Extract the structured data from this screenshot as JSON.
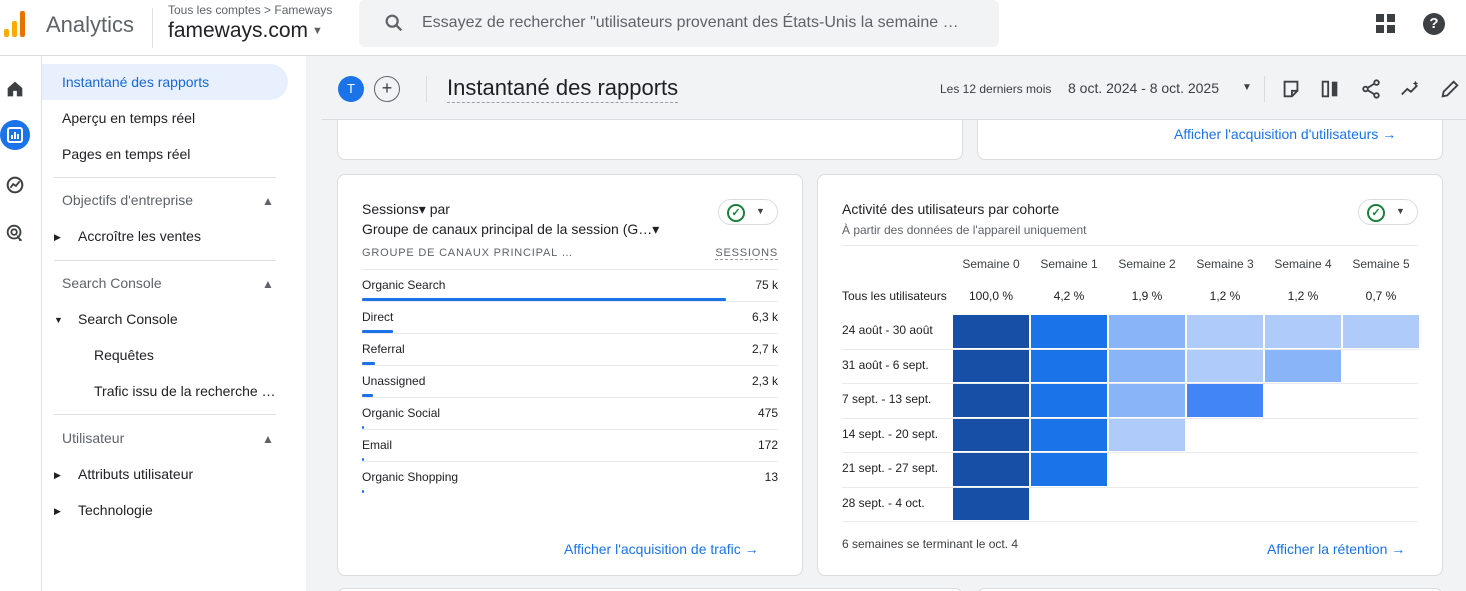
{
  "topbar": {
    "app_name": "Analytics",
    "crumbs": "Tous les comptes > Fameways",
    "property": "fameways.com",
    "search_placeholder": "Essayez de rechercher \"utilisateurs provenant des États-Unis la semaine …"
  },
  "sidebar": {
    "items": [
      {
        "label": "Instantané des rapports"
      },
      {
        "label": "Aperçu en temps réel"
      },
      {
        "label": "Pages en temps réel"
      }
    ],
    "sections": [
      {
        "title": "Objectifs d'entreprise",
        "children": [
          "Accroître les ventes"
        ]
      },
      {
        "title": "Search Console",
        "children": [
          "Search Console",
          "Requêtes",
          "Trafic issu de la recherche …"
        ]
      },
      {
        "title": "Utilisateur",
        "children": [
          "Attributs utilisateur",
          "Technologie"
        ]
      }
    ]
  },
  "header": {
    "avatar_letter": "T",
    "add_symbol": "+",
    "title": "Instantané des rapports",
    "range_label": "Les 12 derniers mois",
    "range_value": "8 oct. 2024 - 8 oct. 2025"
  },
  "top_card": {
    "link": "Afficher l'acquisition d'utilisateurs →"
  },
  "sessions_card": {
    "title": "Sessions▾ par",
    "subtitle": "Groupe de canaux principal de la session (G…▾",
    "col_left": "GROUPE DE CANAUX PRINCIPAL …",
    "col_right": "SESSIONS",
    "rows": [
      {
        "label": "Organic Search",
        "value": "75 k",
        "share": 1.0
      },
      {
        "label": "Direct",
        "value": "6,3 k",
        "share": 0.084
      },
      {
        "label": "Referral",
        "value": "2,7 k",
        "share": 0.036
      },
      {
        "label": "Unassigned",
        "value": "2,3 k",
        "share": 0.031
      },
      {
        "label": "Organic Social",
        "value": "475",
        "share": 0.0063
      },
      {
        "label": "Email",
        "value": "172",
        "share": 0.0023
      },
      {
        "label": "Organic Shopping",
        "value": "13",
        "share": 0.0002
      }
    ],
    "link": "Afficher l'acquisition de trafic →"
  },
  "cohort_card": {
    "title": "Activité des utilisateurs par cohorte",
    "subtitle": "À partir des données de l'appareil uniquement",
    "weeks": [
      "Semaine 0",
      "Semaine 1",
      "Semaine 2",
      "Semaine 3",
      "Semaine 4",
      "Semaine 5"
    ],
    "all_label": "Tous les utilisateurs",
    "all_values": [
      "100,0 %",
      "4,2 %",
      "1,9 %",
      "1,2 %",
      "1,2 %",
      "0,7 %"
    ],
    "cohorts": [
      {
        "label": "24 août - 30 août",
        "levels": [
          5,
          4,
          2,
          1,
          1,
          1
        ]
      },
      {
        "label": "31 août - 6 sept.",
        "levels": [
          5,
          4,
          2,
          1,
          2
        ]
      },
      {
        "label": "7 sept. - 13 sept.",
        "levels": [
          5,
          4,
          2,
          3
        ]
      },
      {
        "label": "14 sept. - 20 sept.",
        "levels": [
          5,
          4,
          1
        ]
      },
      {
        "label": "21 sept. - 27 sept.",
        "levels": [
          5,
          4
        ]
      },
      {
        "label": "28 sept. - 4 oct.",
        "levels": [
          5
        ]
      }
    ],
    "level_colors": {
      "1": "#aecbfa",
      "2": "#8ab4f8",
      "3": "#4285f4",
      "4": "#1a73e8",
      "5": "#174ea6"
    },
    "footer": "6 semaines se terminant le oct. 4",
    "link": "Afficher la rétention →"
  }
}
